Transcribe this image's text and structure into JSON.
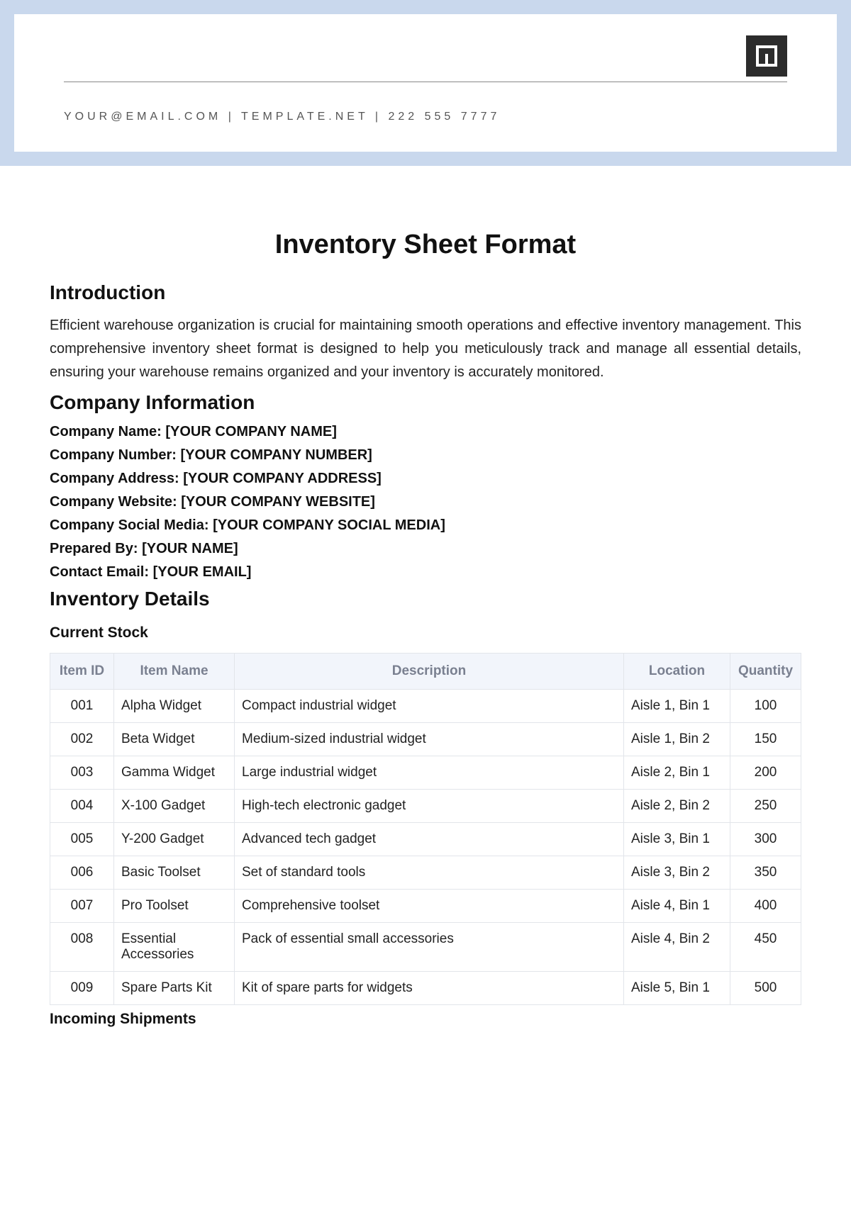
{
  "header": {
    "contact": "YOUR@EMAIL.COM | TEMPLATE.NET | 222 555 7777"
  },
  "title": "Inventory Sheet Format",
  "intro": {
    "heading": "Introduction",
    "text": "Efficient warehouse organization is crucial for maintaining smooth operations and effective inventory management. This comprehensive inventory sheet format is designed to help you meticulously track and manage all essential details, ensuring your warehouse remains organized and your inventory is accurately monitored."
  },
  "company": {
    "heading": "Company Information",
    "fields": [
      {
        "label": "Company Name:",
        "value": "[YOUR COMPANY NAME]"
      },
      {
        "label": "Company Number:",
        "value": "[YOUR COMPANY NUMBER]"
      },
      {
        "label": "Company Address:",
        "value": "[YOUR COMPANY ADDRESS]"
      },
      {
        "label": "Company Website:",
        "value": "[YOUR COMPANY WEBSITE]"
      },
      {
        "label": "Company Social Media:",
        "value": "[YOUR COMPANY SOCIAL MEDIA]"
      },
      {
        "label": "Prepared By:",
        "value": "[YOUR NAME]"
      },
      {
        "label": "Contact Email:",
        "value": "[YOUR EMAIL]"
      }
    ]
  },
  "inventory": {
    "heading": "Inventory Details",
    "current_stock_heading": "Current Stock",
    "columns": [
      "Item ID",
      "Item Name",
      "Description",
      "Location",
      "Quantity"
    ],
    "rows": [
      {
        "id": "001",
        "name": "Alpha Widget",
        "desc": "Compact industrial widget",
        "loc": "Aisle 1, Bin 1",
        "qty": "100"
      },
      {
        "id": "002",
        "name": "Beta Widget",
        "desc": "Medium-sized industrial widget",
        "loc": "Aisle 1, Bin 2",
        "qty": "150"
      },
      {
        "id": "003",
        "name": "Gamma Widget",
        "desc": "Large industrial widget",
        "loc": "Aisle 2, Bin 1",
        "qty": "200"
      },
      {
        "id": "004",
        "name": "X-100 Gadget",
        "desc": "High-tech electronic gadget",
        "loc": "Aisle 2, Bin 2",
        "qty": "250"
      },
      {
        "id": "005",
        "name": "Y-200 Gadget",
        "desc": "Advanced tech gadget",
        "loc": "Aisle 3, Bin 1",
        "qty": "300"
      },
      {
        "id": "006",
        "name": "Basic Toolset",
        "desc": "Set of standard tools",
        "loc": "Aisle 3, Bin 2",
        "qty": "350"
      },
      {
        "id": "007",
        "name": "Pro Toolset",
        "desc": "Comprehensive toolset",
        "loc": "Aisle 4, Bin 1",
        "qty": "400"
      },
      {
        "id": "008",
        "name": "Essential Accessories",
        "desc": "Pack of essential small accessories",
        "loc": "Aisle 4, Bin 2",
        "qty": "450"
      },
      {
        "id": "009",
        "name": "Spare Parts Kit",
        "desc": "Kit of spare parts for widgets",
        "loc": "Aisle 5, Bin 1",
        "qty": "500"
      }
    ],
    "incoming_heading": "Incoming Shipments"
  }
}
